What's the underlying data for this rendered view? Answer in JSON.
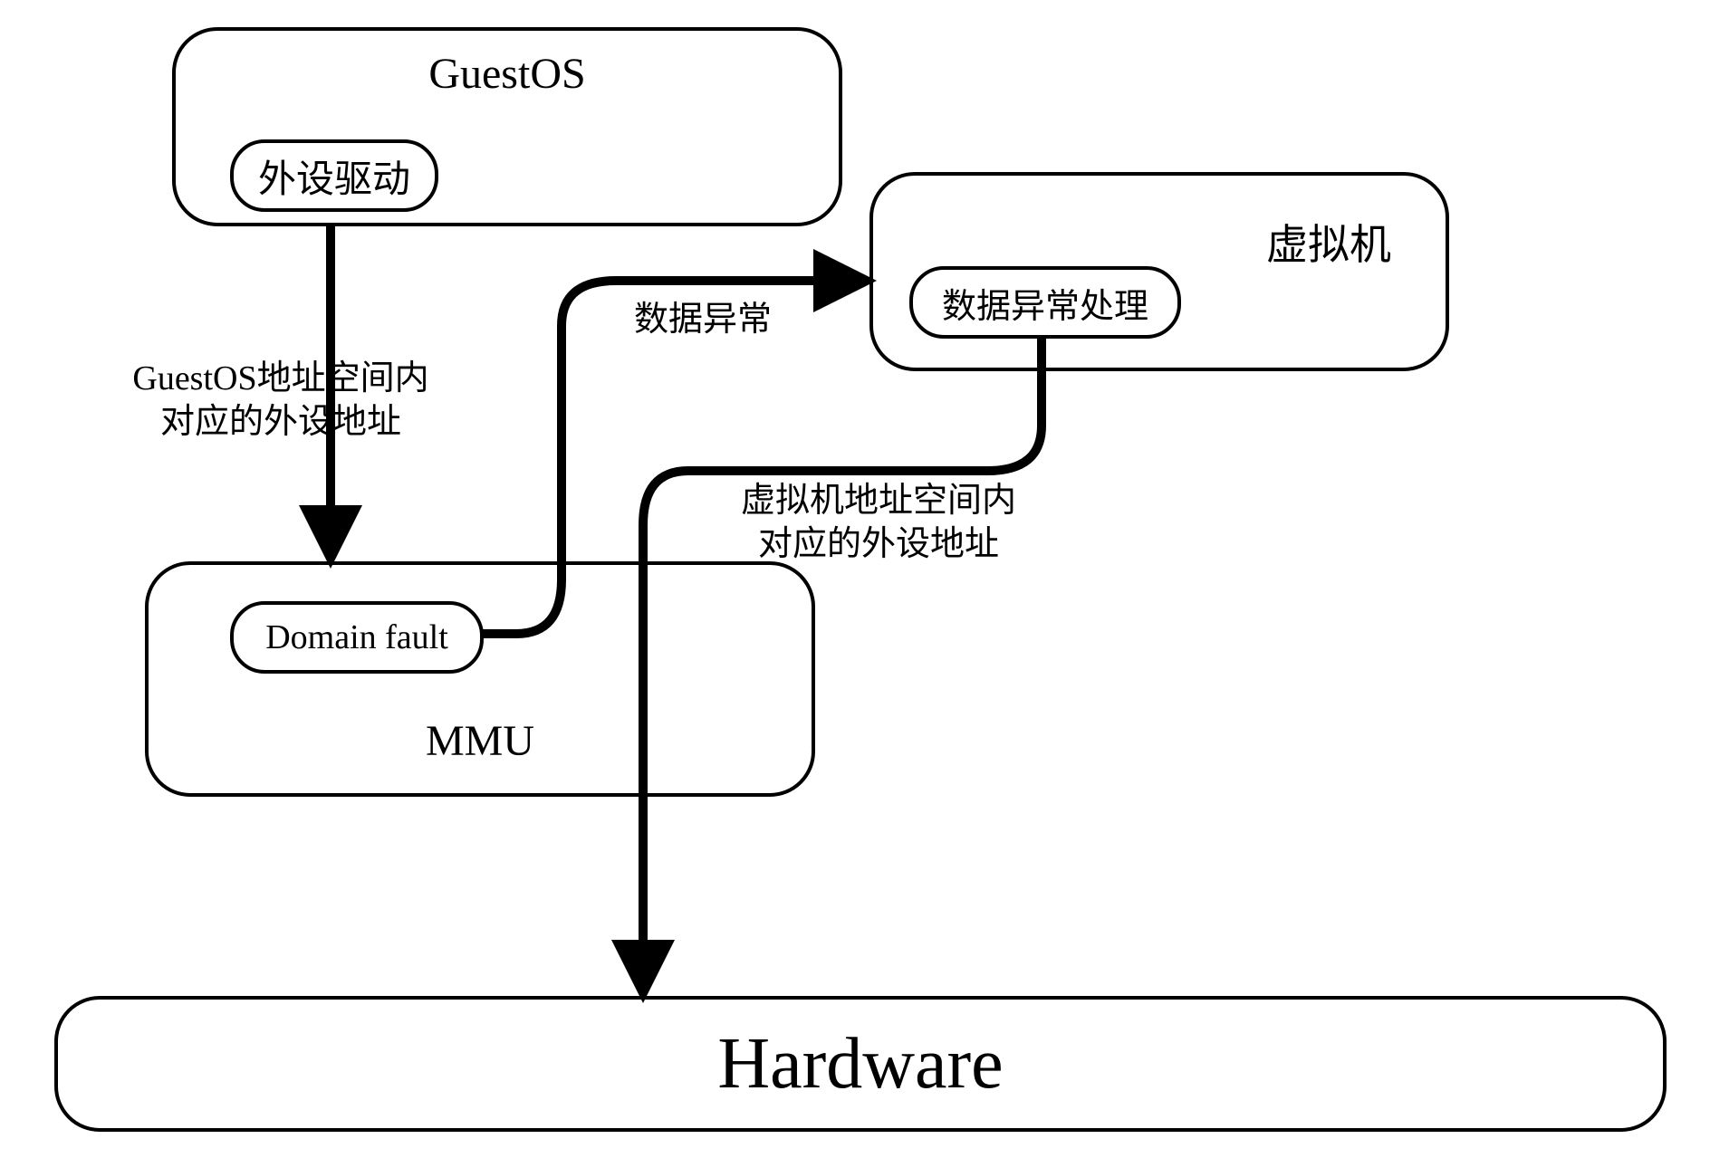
{
  "nodes": {
    "guestos": {
      "title": "GuestOS",
      "inner": "外设驱动"
    },
    "vm": {
      "title": "虚拟机",
      "inner": "数据异常处理"
    },
    "mmu": {
      "title": "MMU",
      "inner": "Domain fault"
    },
    "hardware": {
      "title": "Hardware"
    }
  },
  "edges": {
    "guestos_to_mmu": "GuestOS地址空间内\n对应的外设地址",
    "mmu_to_vm": "数据异常",
    "vm_to_hardware": "虚拟机地址空间内\n对应的外设地址"
  }
}
